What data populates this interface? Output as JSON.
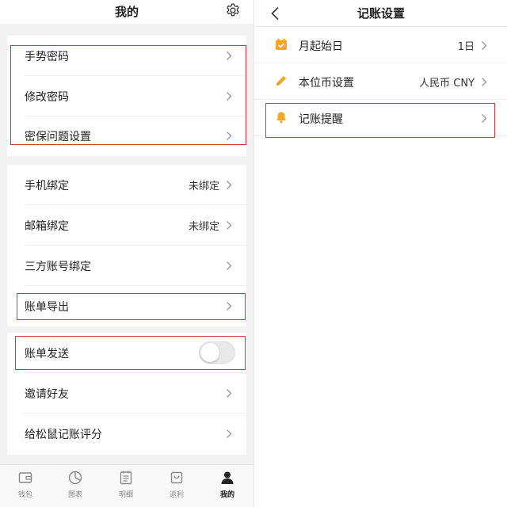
{
  "left_panel": {
    "title": "我的",
    "security_group": [
      {
        "label": "手势密码"
      },
      {
        "label": "修改密码"
      },
      {
        "label": "密保问题设置"
      }
    ],
    "binding_group": [
      {
        "label": "手机绑定",
        "value": "未绑定"
      },
      {
        "label": "邮箱绑定",
        "value": "未绑定"
      },
      {
        "label": "三方账号绑定"
      },
      {
        "label": "账单导出"
      }
    ],
    "other_group": [
      {
        "label": "账单发送",
        "toggle_on": false
      },
      {
        "label": "邀请好友"
      },
      {
        "label": "给松鼠记账评分"
      }
    ],
    "tabbar": [
      {
        "label": "钱包",
        "icon": "wallet-icon"
      },
      {
        "label": "图表",
        "icon": "pie-chart-icon"
      },
      {
        "label": "明细",
        "icon": "list-icon"
      },
      {
        "label": "返利",
        "icon": "bag-icon"
      },
      {
        "label": "我的",
        "icon": "user-icon",
        "active": true
      }
    ]
  },
  "right_panel": {
    "title": "记账设置",
    "rows": [
      {
        "label": "月起始日",
        "value": "1日",
        "icon": "calendar-icon"
      },
      {
        "label": "本位币设置",
        "value": "人民币 CNY",
        "icon": "pencil-icon"
      },
      {
        "label": "记账提醒",
        "icon": "bell-icon"
      }
    ]
  },
  "colors": {
    "highlight": "#d9363e",
    "icon_orange": "#f5a623",
    "background": "#f2f2f2"
  }
}
